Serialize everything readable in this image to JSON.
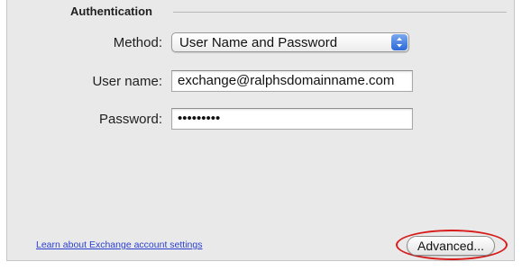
{
  "authentication": {
    "section_title": "Authentication",
    "method": {
      "label": "Method:",
      "selected_value": "User Name and Password",
      "icon": "popup-arrows-icon"
    },
    "username": {
      "label": "User name:",
      "value": "exchange@ralphsdomainname.com"
    },
    "password": {
      "label": "Password:",
      "masked_value": "•••••••••"
    }
  },
  "footer": {
    "learn_link": "Learn about Exchange account settings",
    "advanced_button": "Advanced..."
  },
  "colors": {
    "link": "#2a3fd1",
    "highlight_circle": "#d81c1c",
    "popup_accent": "#2d68d7"
  }
}
